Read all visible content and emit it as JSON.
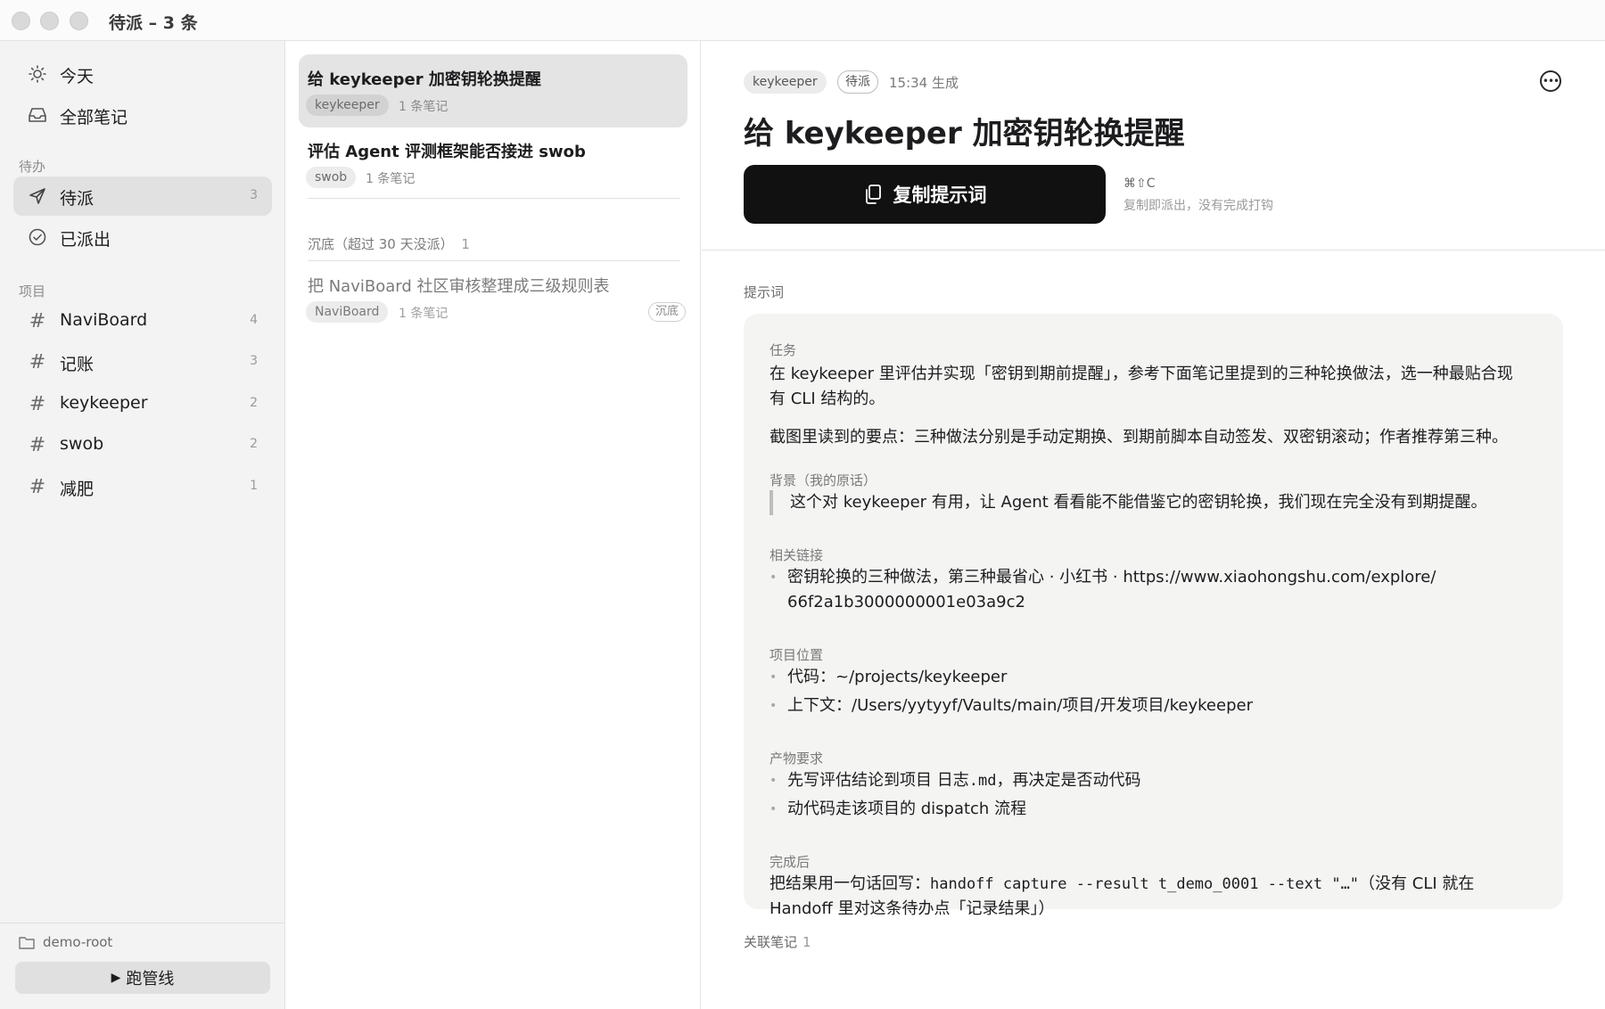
{
  "window": {
    "title": "待派 – 3 条"
  },
  "sidebar": {
    "top_items": [
      {
        "label": "今天",
        "icon": "sun-icon"
      },
      {
        "label": "全部笔记",
        "icon": "inbox-icon"
      }
    ],
    "todo_section": "待办",
    "todo_items": [
      {
        "label": "待派",
        "count": "3",
        "icon": "send-icon"
      },
      {
        "label": "已派出",
        "icon": "check-circle-icon"
      }
    ],
    "projects_section": "项目",
    "projects": [
      {
        "label": "NaviBoard",
        "count": "4"
      },
      {
        "label": "记账",
        "count": "3"
      },
      {
        "label": "keykeeper",
        "count": "2"
      },
      {
        "label": "swob",
        "count": "2"
      },
      {
        "label": "减肥",
        "count": "1"
      }
    ],
    "root_label": "demo-root",
    "run_button": "跑管线"
  },
  "list": {
    "items": [
      {
        "title": "给 keykeeper 加密钥轮换提醒",
        "tag": "keykeeper",
        "notes": "1 条笔记"
      },
      {
        "title": "评估 Agent 评测框架能否接进 swob",
        "tag": "swob",
        "notes": "1 条笔记"
      }
    ],
    "sunk_header": "沉底（超过 30 天没派）",
    "sunk_count": "1",
    "sunk_items": [
      {
        "title": "把 NaviBoard 社区审核整理成三级规则表",
        "tag": "NaviBoard",
        "notes": "1 条笔记",
        "badge": "沉底"
      }
    ]
  },
  "detail": {
    "tag": "keykeeper",
    "status": "待派",
    "time": "15:34 生成",
    "title": "给 keykeeper 加密钥轮换提醒",
    "copy_button": "复制提示词",
    "shortcut": "⌘⇧C",
    "shortcut_hint": "复制即派出，没有完成打钩",
    "prompt_label": "提示词",
    "prompt": {
      "task_heading": "任务",
      "task_line1": "在 keykeeper 里评估并实现「密钥到期前提醒」，参考下面笔记里提到的三种轮换做法，选一种最贴合现",
      "task_line2": "有 CLI 结构的。",
      "task_points": "截图里读到的要点：三种做法分别是手动定期换、到期前脚本自动签发、双密钥滚动；作者推荐第三种。",
      "background_heading": "背景（我的原话）",
      "background_quote": "这个对 keykeeper 有用，让 Agent 看看能不能借鉴它的密钥轮换，我们现在完全没有到期提醒。",
      "links_heading": "相关链接",
      "link_line1": "密钥轮换的三种做法，第三种最省心 · 小红书 · https://www.xiaohongshu.com/explore/",
      "link_line2": "66f2a1b3000000001e03a9c2",
      "location_heading": "项目位置",
      "location_code": "代码：~/projects/keykeeper",
      "location_context": "上下文：/Users/yytyyf/Vaults/main/项目/开发项目/keykeeper",
      "output_heading": "产物要求",
      "output_1_pre": "先写评估结论到项目 日志",
      "output_1_code": ".md",
      "output_1_post": "，再决定是否动代码",
      "output_2": "动代码走该项目的 dispatch 流程",
      "after_heading": "完成后",
      "after_pre": "把结果用一句话回写：",
      "after_code": "handoff capture --result t_demo_0001 --text \"…\"",
      "after_post": "（没有 CLI 就在",
      "after_line2": "Handoff 里对这条待办点「记录结果」）"
    },
    "related_label": "关联笔记",
    "related_count": "1"
  }
}
